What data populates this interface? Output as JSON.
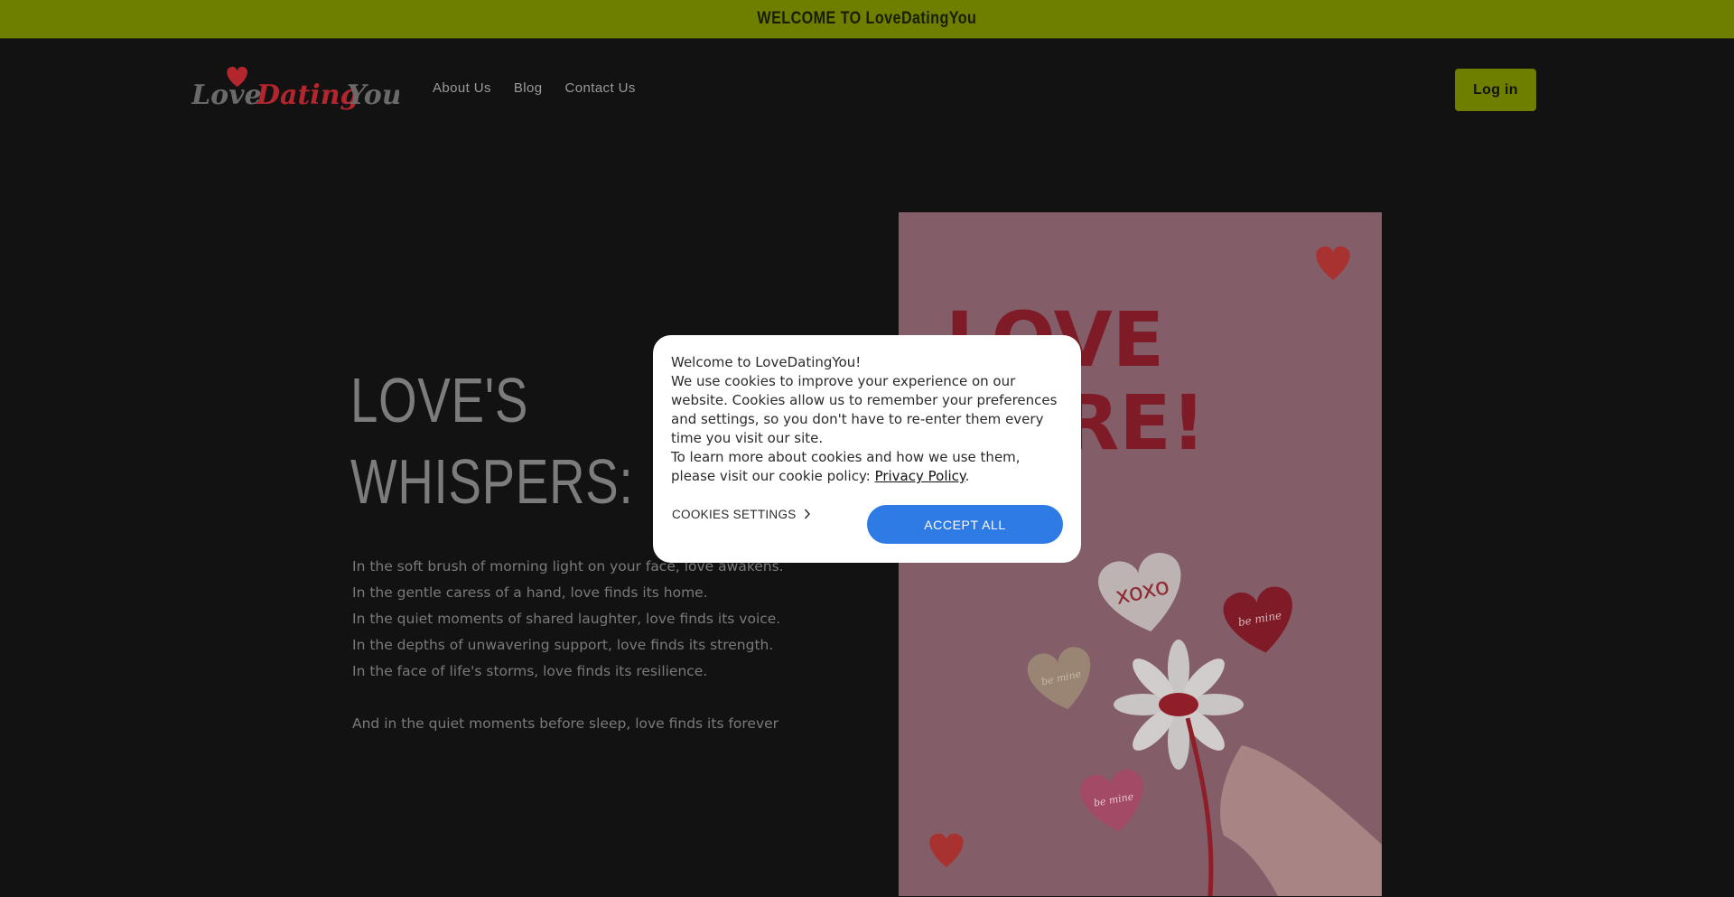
{
  "announcement": {
    "text": "WELCOME TO LoveDatingYou"
  },
  "header": {
    "logo_text_love": "Love",
    "logo_text_dating": "Dating",
    "logo_text_you": "You",
    "nav": [
      {
        "label": "About Us"
      },
      {
        "label": "Blog"
      },
      {
        "label": "Contact Us"
      }
    ],
    "login_label": "Log in"
  },
  "hero": {
    "title_line1": "LOVE'S",
    "title_line2": "WHISPERS:",
    "poem": [
      "In the soft brush of morning light on your face, love awakens.",
      "In the gentle caress of a hand, love finds its home.",
      "In the quiet moments of shared laughter, love finds its voice.",
      "In the depths of unwavering support, love finds its strength.",
      "In the face of life's storms, love finds its resilience."
    ],
    "poem_final": "And in the quiet moments before sleep, love finds its forever"
  },
  "artwork": {
    "headline_line1": "LOVE",
    "headline_line2": "HERE!",
    "xoxo": "xoxo",
    "be_mine": "be mine"
  },
  "cookie_dialog": {
    "greeting": "Welcome to LoveDatingYou!",
    "body": "We use cookies to improve your experience on our website. Cookies allow us to remember your preferences and settings, so you don't have to re-enter them every time you visit our site.",
    "policy_prefix": "To learn more about cookies and how we use them, please visit our cookie policy: ",
    "policy_link": "Privacy Policy",
    "policy_suffix": ".",
    "settings_label": "COOKIES SETTINGS",
    "accept_label": "ACCEPT ALL"
  },
  "colors": {
    "accent": "#6e7f00",
    "background": "#121212",
    "accept_button": "#2f7be5",
    "artwork_bg": "#835e69",
    "heart_red": "#8f1e28"
  }
}
